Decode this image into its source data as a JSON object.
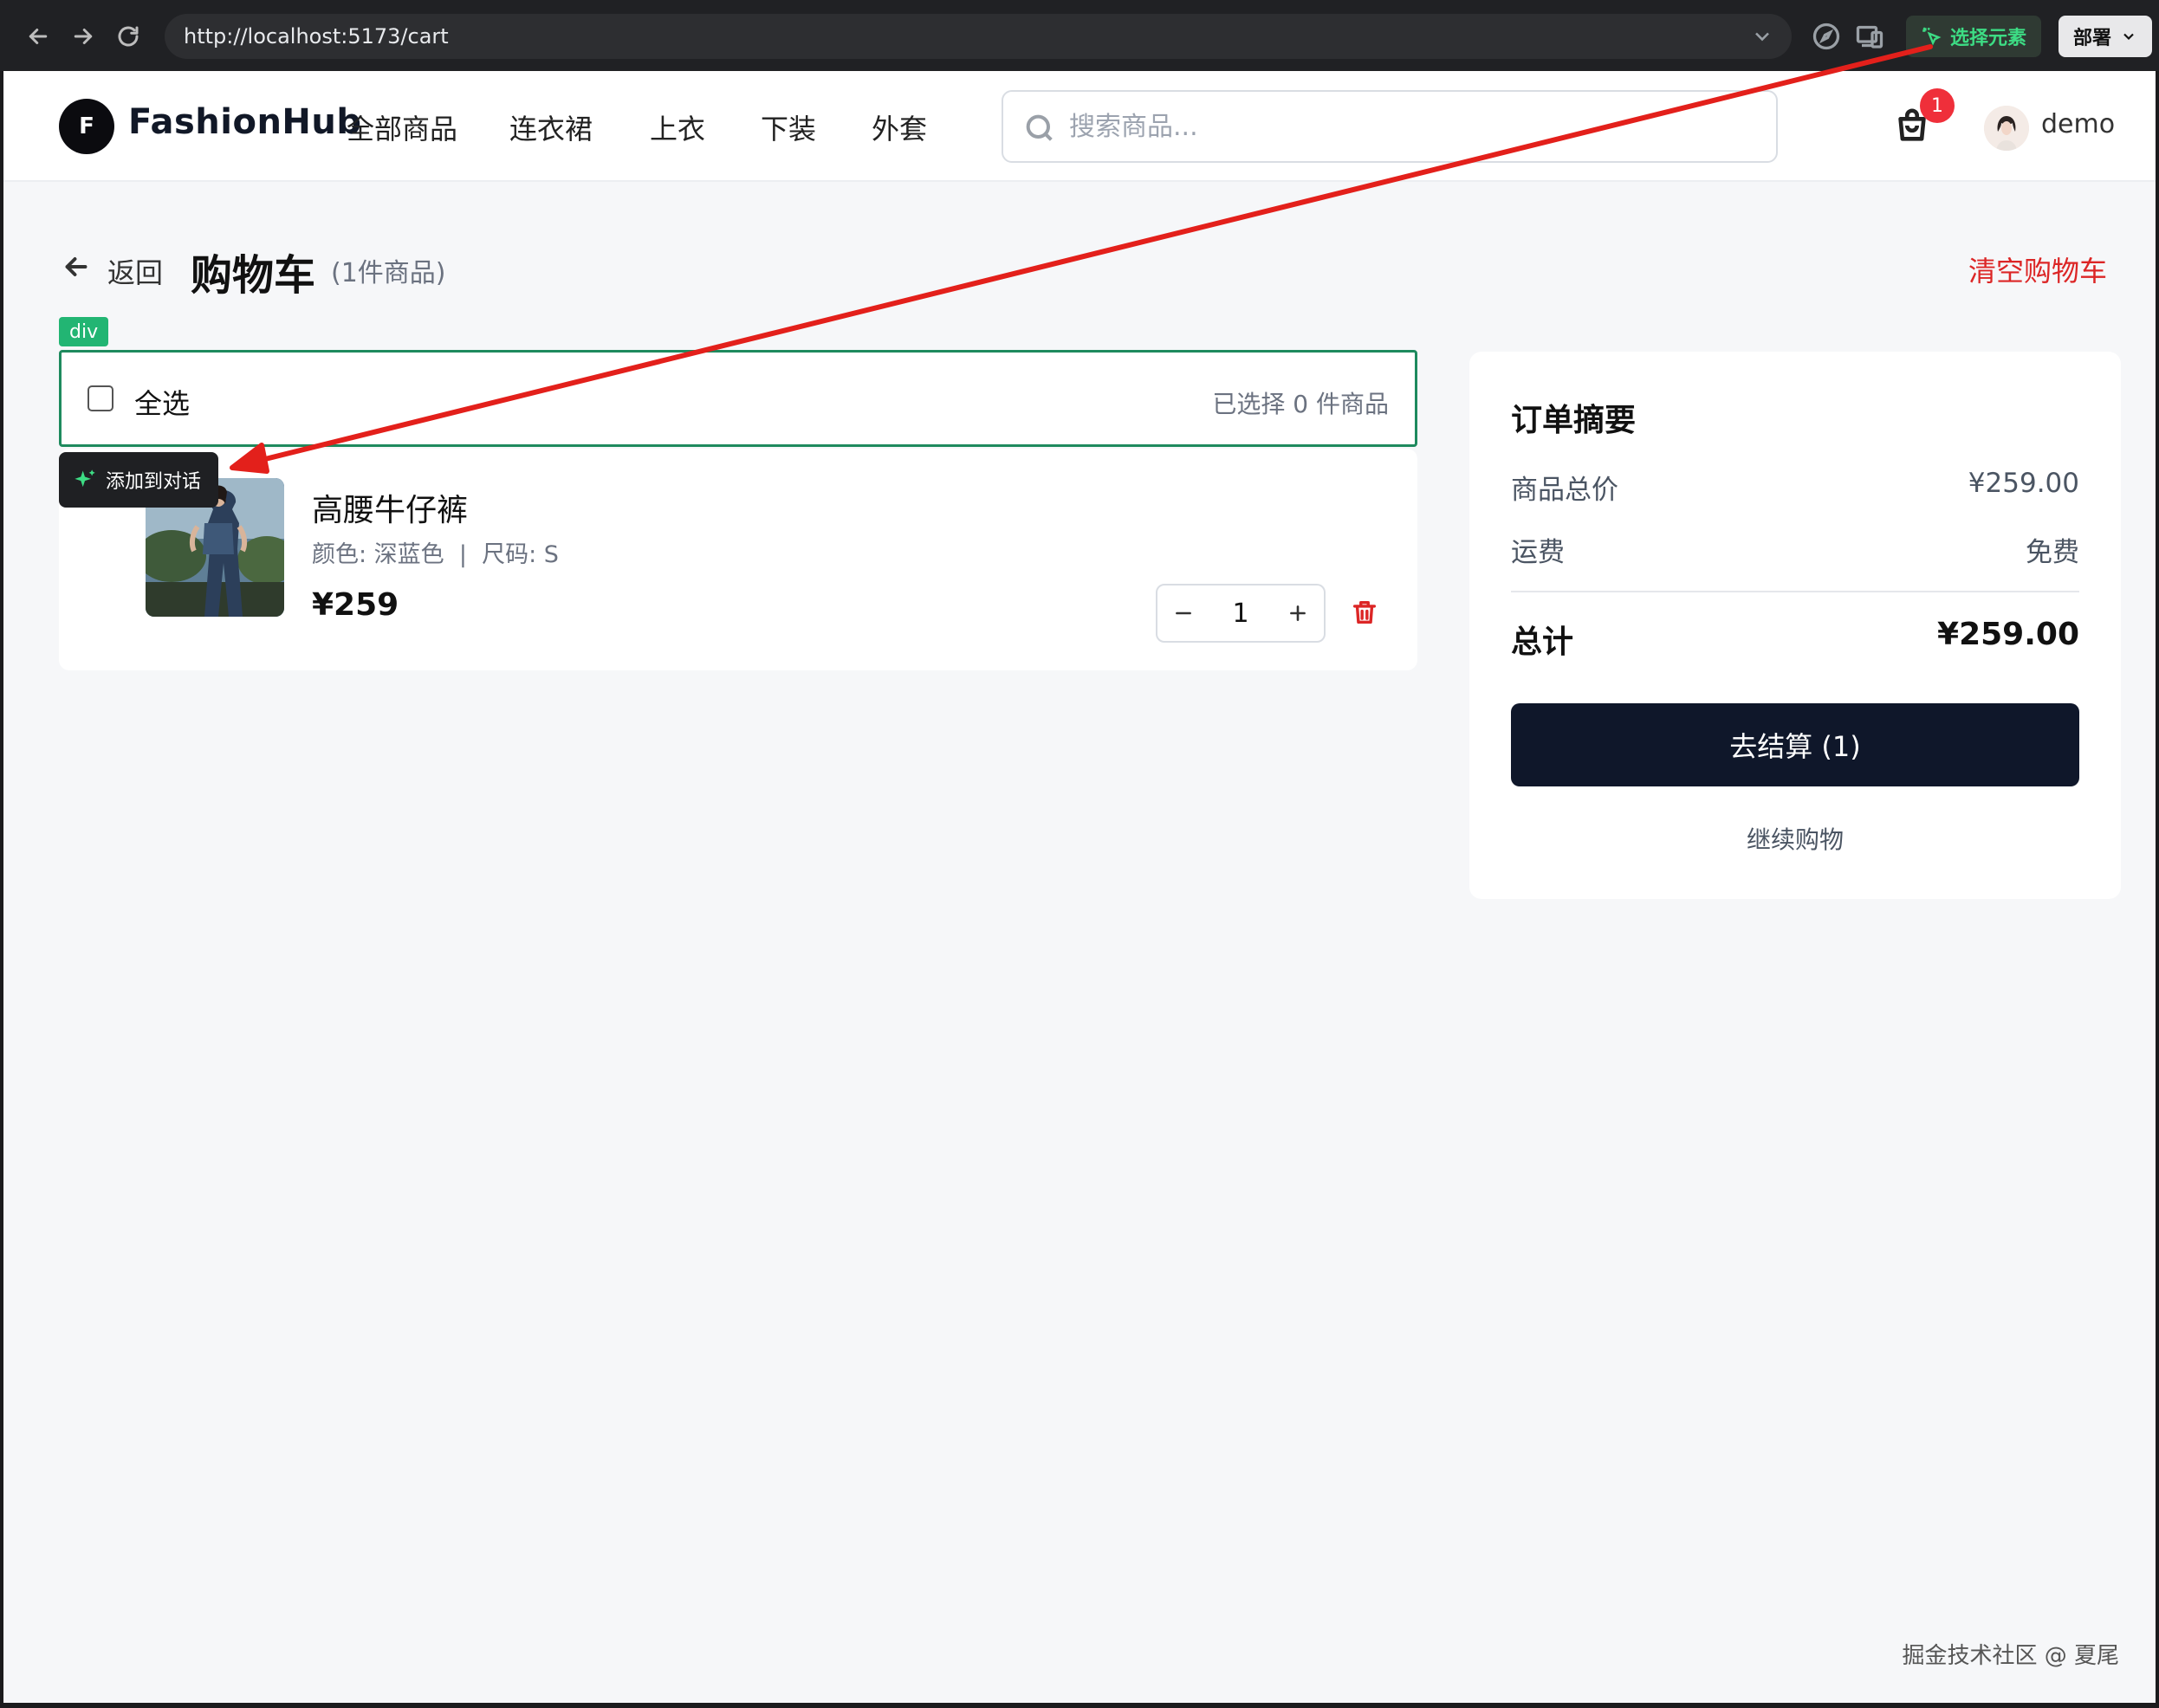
{
  "browser": {
    "url": "http://localhost:5173/cart",
    "select_element_label": "选择元素",
    "deploy_label": "部署"
  },
  "header": {
    "logo_letter": "F",
    "logo_text": "FashionHub",
    "nav": [
      "全部商品",
      "连衣裙",
      "上衣",
      "下装",
      "外套"
    ],
    "search_placeholder": "搜索商品...",
    "cart_count": "1",
    "user_name": "demo"
  },
  "page": {
    "back_label": "返回",
    "title": "购物车",
    "item_count": "(1件商品)",
    "clear_label": "清空购物车"
  },
  "inspector": {
    "tag": "div",
    "add_to_chat": "添加到对话"
  },
  "selection": {
    "select_all_label": "全选",
    "selected_text": "已选择 0 件商品"
  },
  "cart_items": [
    {
      "name": "高腰牛仔裤",
      "variant": "颜色: 深蓝色  |  尺码: S",
      "price": "¥259",
      "quantity": "1"
    }
  ],
  "summary": {
    "title": "订单摘要",
    "subtotal_label": "商品总价",
    "subtotal_value": "¥259.00",
    "shipping_label": "运费",
    "shipping_value": "免费",
    "total_label": "总计",
    "total_value": "¥259.00",
    "checkout_label": "去结算 (1)",
    "continue_label": "继续购物"
  },
  "watermark": "掘金技术社区 @ 夏尾",
  "colors": {
    "accent_red": "#dc2626",
    "primary_dark": "#0f172a",
    "inspector_green": "#1e8a5e",
    "annotation_red": "#e3201b"
  }
}
